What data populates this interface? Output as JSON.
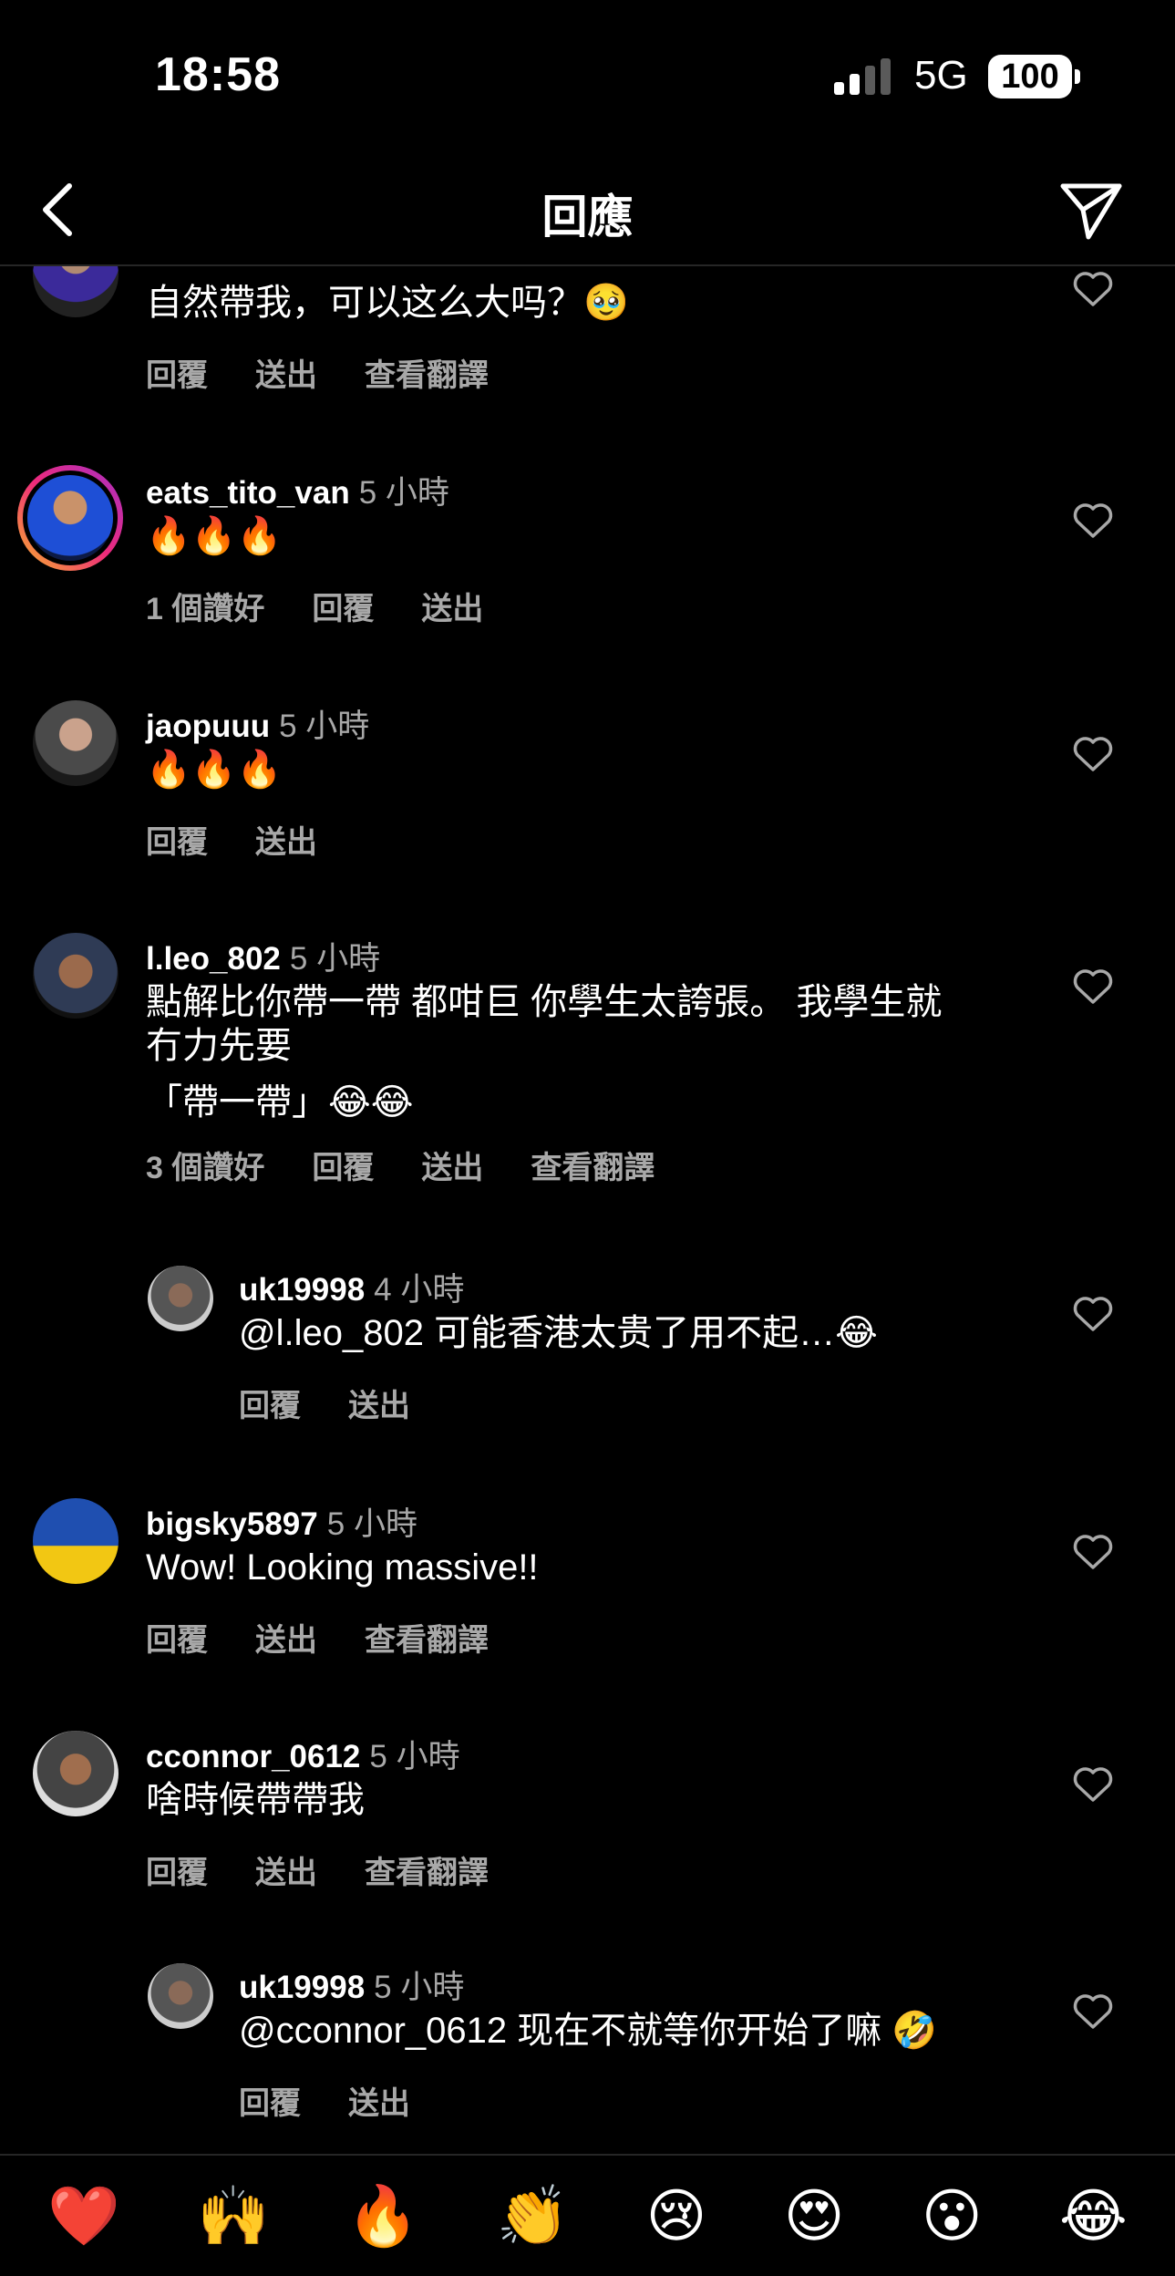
{
  "status": {
    "time": "18:58",
    "network": "5G",
    "battery": "100"
  },
  "nav": {
    "title": "回應"
  },
  "comments": [
    {
      "text": "自然帶我，可以这么大吗？🥹",
      "actions": [
        "回覆",
        "送出",
        "查看翻譯"
      ]
    },
    {
      "user": "eats_tito_van",
      "time": "5 小時",
      "text": "🔥🔥🔥",
      "actions": [
        "1 個讚好",
        "回覆",
        "送出"
      ]
    },
    {
      "user": "jaopuuu",
      "time": "5 小時",
      "text": "🔥🔥🔥",
      "actions": [
        "回覆",
        "送出"
      ]
    },
    {
      "user": "l.leo_802",
      "time": "5 小時",
      "text_lines": [
        "點解比你帶一帶 都咁巨 你學生太誇張。 我學生就",
        "冇力先要",
        "「帶一帶」😂😂"
      ],
      "actions": [
        "3 個讚好",
        "回覆",
        "送出",
        "查看翻譯"
      ]
    },
    {
      "user": "uk19998",
      "time": "4 小時",
      "text": "@l.leo_802 可能香港太贵了用不起…😂",
      "actions": [
        "回覆",
        "送出"
      ]
    },
    {
      "user": "bigsky5897",
      "time": "5 小時",
      "text": "Wow! Looking massive!!",
      "actions": [
        "回覆",
        "送出",
        "查看翻譯"
      ]
    },
    {
      "user": "cconnor_0612",
      "time": "5 小時",
      "text": "啥時候帶帶我",
      "actions": [
        "回覆",
        "送出",
        "查看翻譯"
      ]
    },
    {
      "user": "uk19998",
      "time": "5 小時",
      "text": "@cconnor_0612 现在不就等你开始了嘛 🤣",
      "actions": [
        "回覆",
        "送出"
      ]
    }
  ],
  "emoji_bar": [
    "❤️",
    "🙌",
    "🔥",
    "👏",
    "😢",
    "😍",
    "😮",
    "😂"
  ],
  "icons": [
    "back-chevron-icon",
    "paper-plane-icon",
    "heart-outline-icon"
  ]
}
